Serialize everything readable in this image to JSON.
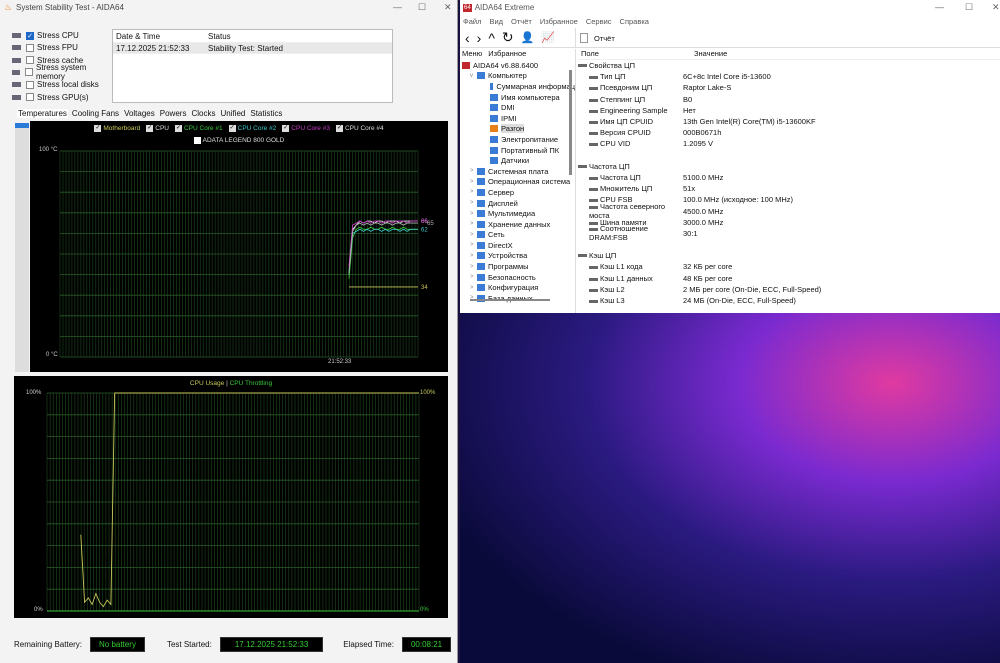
{
  "stability": {
    "title": "System Stability Test - AIDA64",
    "stress": [
      {
        "label": "Stress CPU",
        "checked": true
      },
      {
        "label": "Stress FPU",
        "checked": false
      },
      {
        "label": "Stress cache",
        "checked": false
      },
      {
        "label": "Stress system memory",
        "checked": false
      },
      {
        "label": "Stress local disks",
        "checked": false
      },
      {
        "label": "Stress GPU(s)",
        "checked": false
      }
    ],
    "log_headers": [
      "Date & Time",
      "Status"
    ],
    "log_rows": [
      [
        "17.12.2025 21:52:33",
        "Stability Test: Started"
      ]
    ],
    "tabs": [
      "Temperatures",
      "Cooling Fans",
      "Voltages",
      "Powers",
      "Clocks",
      "Unified",
      "Statistics"
    ],
    "status": {
      "battery_label": "Remaining Battery:",
      "battery_value": "No battery",
      "started_label": "Test Started:",
      "started_value": "17.12.2025 21:52:33",
      "elapsed_label": "Elapsed Time:",
      "elapsed_value": "00:08:21"
    }
  },
  "chart_data": [
    {
      "type": "line",
      "title": "Temperatures",
      "ylim": [
        0,
        100
      ],
      "ytick_top": "100 °C",
      "ytick_bottom": "0 °C",
      "xlabel_time": "21:52:33",
      "extra_legend": "ADATA LEGEND 800 GOLD",
      "series": [
        {
          "name": "Motherboard",
          "color": "#c8c85a",
          "values": [
            34,
            34,
            34,
            34,
            34,
            34,
            34,
            34,
            34,
            34,
            34,
            34,
            34,
            34,
            34,
            34,
            34,
            34,
            34,
            34
          ],
          "end_label": "34"
        },
        {
          "name": "CPU",
          "color": "#e0e0e0",
          "values": [
            40,
            62,
            64,
            66,
            65,
            66,
            66,
            65,
            66,
            66,
            65,
            66,
            66,
            66,
            65,
            66,
            66,
            66,
            66,
            66
          ],
          "end_label": "66"
        },
        {
          "name": "CPU Core #1",
          "color": "#3cc83c",
          "values": [
            38,
            58,
            62,
            63,
            62,
            62,
            63,
            62,
            62,
            63,
            62,
            62,
            63,
            62,
            62,
            63,
            62,
            62,
            62,
            62
          ],
          "end_label": ""
        },
        {
          "name": "CPU Core #2",
          "color": "#3cc8c8",
          "values": [
            42,
            60,
            61,
            62,
            61,
            62,
            61,
            62,
            62,
            61,
            62,
            61,
            62,
            62,
            61,
            62,
            61,
            62,
            62,
            62
          ],
          "end_label": "62"
        },
        {
          "name": "CPU Core #3",
          "color": "#c83cc8",
          "values": [
            44,
            64,
            65,
            66,
            65,
            66,
            65,
            66,
            66,
            65,
            66,
            66,
            65,
            66,
            66,
            66,
            65,
            66,
            66,
            66
          ],
          "end_label": "66"
        },
        {
          "name": "CPU Core #4",
          "color": "#b0b0b0",
          "values": [
            41,
            61,
            64,
            65,
            64,
            65,
            64,
            65,
            65,
            64,
            65,
            65,
            64,
            65,
            65,
            64,
            65,
            65,
            65,
            65
          ],
          "end_label": "65"
        }
      ]
    },
    {
      "type": "line",
      "title": "CPU Usage",
      "title2": "CPU Throttling",
      "ylim": [
        0,
        100
      ],
      "ytick_top": "100%",
      "ytick_bottom": "0%",
      "right_top": "100%",
      "right_bottom": "0%",
      "series": [
        {
          "name": "CPU Usage",
          "color": "#c8c85a",
          "values": [
            null,
            null,
            null,
            null,
            null,
            null,
            null,
            null,
            null,
            35,
            4,
            6,
            3,
            8,
            4,
            2,
            5,
            3,
            100,
            100,
            100,
            100,
            100,
            100,
            100,
            100,
            100,
            100,
            100,
            100,
            100,
            100,
            100,
            100,
            100,
            100,
            100,
            100,
            100,
            100,
            100,
            100,
            100,
            100,
            100,
            100,
            100,
            100,
            100,
            100,
            100,
            100,
            100,
            100,
            100,
            100,
            100,
            100,
            100,
            100,
            100,
            100,
            100,
            100,
            100,
            100,
            100,
            100,
            100,
            100,
            100,
            100,
            100,
            100,
            100,
            100,
            100,
            100,
            100,
            100,
            100,
            100,
            100,
            100,
            100,
            100,
            100,
            100,
            100,
            100,
            100,
            100,
            100,
            100,
            100,
            100,
            100,
            100,
            100,
            100
          ]
        },
        {
          "name": "CPU Throttling",
          "color": "#3cc83c",
          "values": [
            0
          ]
        }
      ]
    }
  ],
  "aida": {
    "title": "AIDA64 Extreme",
    "menu": [
      "Файл",
      "Вид",
      "Отчёт",
      "Избранное",
      "Сервис",
      "Справка"
    ],
    "report_label": "Отчёт",
    "panel_tabs": [
      "Меню",
      "Избранное"
    ],
    "tree": [
      {
        "label": "AIDA64 v6.88.6400",
        "level": 0
      },
      {
        "label": "Компьютер",
        "level": 1,
        "expander": "v"
      },
      {
        "label": "Суммарная информац",
        "level": 2
      },
      {
        "label": "Имя компьютера",
        "level": 2
      },
      {
        "label": "DMI",
        "level": 2
      },
      {
        "label": "IPMI",
        "level": 2
      },
      {
        "label": "Разгон",
        "level": 2,
        "selected": true
      },
      {
        "label": "Электропитание",
        "level": 2
      },
      {
        "label": "Портативный ПК",
        "level": 2
      },
      {
        "label": "Датчики",
        "level": 2
      },
      {
        "label": "Системная плата",
        "level": 1,
        "expander": ">"
      },
      {
        "label": "Операционная система",
        "level": 1,
        "expander": ">"
      },
      {
        "label": "Сервер",
        "level": 1,
        "expander": ">"
      },
      {
        "label": "Дисплей",
        "level": 1,
        "expander": ">"
      },
      {
        "label": "Мультимедиа",
        "level": 1,
        "expander": ">"
      },
      {
        "label": "Хранение данных",
        "level": 1,
        "expander": ">"
      },
      {
        "label": "Сеть",
        "level": 1,
        "expander": ">"
      },
      {
        "label": "DirectX",
        "level": 1,
        "expander": ">"
      },
      {
        "label": "Устройства",
        "level": 1,
        "expander": ">"
      },
      {
        "label": "Программы",
        "level": 1,
        "expander": ">"
      },
      {
        "label": "Безопасность",
        "level": 1,
        "expander": ">"
      },
      {
        "label": "Конфигурация",
        "level": 1,
        "expander": ">"
      },
      {
        "label": "База данных",
        "level": 1,
        "expander": ">"
      }
    ],
    "columns": [
      "Поле",
      "Значение"
    ],
    "rows": [
      {
        "group": "Свойства ЦП"
      },
      {
        "field": "Тип ЦП",
        "value": "6C+8c Intel Core i5-13600"
      },
      {
        "field": "Псевдоним ЦП",
        "value": "Raptor Lake-S"
      },
      {
        "field": "Степпинг ЦП",
        "value": "B0"
      },
      {
        "field": "Engineering Sample",
        "value": "Нет"
      },
      {
        "field": "Имя ЦП CPUID",
        "value": "13th Gen Intel(R) Core(TM) i5-13600KF"
      },
      {
        "field": "Версия CPUID",
        "value": "000B0671h"
      },
      {
        "field": "CPU VID",
        "value": "1.2095 V"
      },
      {
        "blank": true
      },
      {
        "group": "Частота ЦП"
      },
      {
        "field": "Частота ЦП",
        "value": "5100.0 MHz"
      },
      {
        "field": "Множитель ЦП",
        "value": "51x"
      },
      {
        "field": "CPU FSB",
        "value": "100.0 MHz  (исходное: 100 MHz)"
      },
      {
        "field": "Частота северного моста",
        "value": "4500.0 MHz"
      },
      {
        "field": "Шина памяти",
        "value": "3000.0 MHz"
      },
      {
        "field": "Соотношение DRAM:FSB",
        "value": "30:1"
      },
      {
        "blank": true
      },
      {
        "group": "Кэш ЦП"
      },
      {
        "field": "Кэш L1 кода",
        "value": "32 КБ per core"
      },
      {
        "field": "Кэш L1 данных",
        "value": "48 КБ per core"
      },
      {
        "field": "Кэш L2",
        "value": "2 МБ per core  (On-Die, ECC, Full-Speed)"
      },
      {
        "field": "Кэш L3",
        "value": "24 МБ  (On-Die, ECC, Full-Speed)"
      }
    ]
  }
}
